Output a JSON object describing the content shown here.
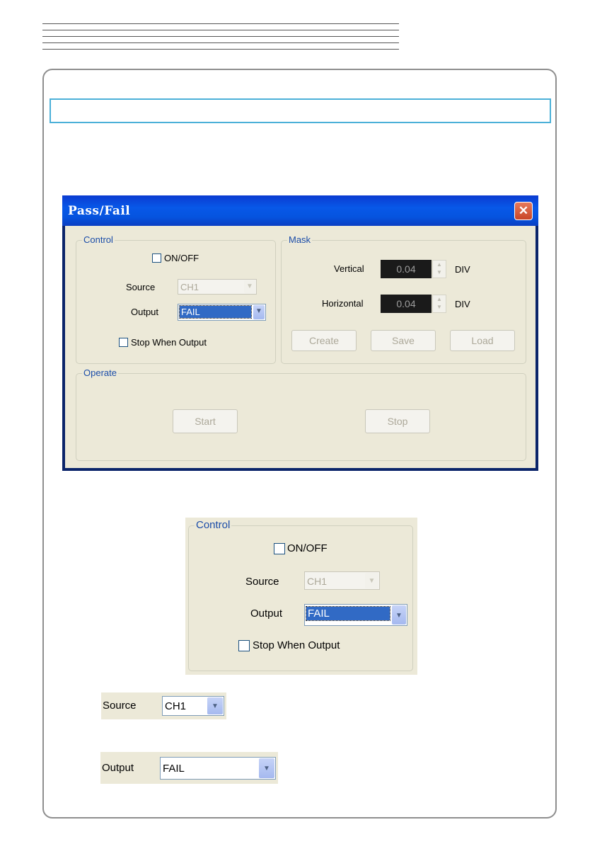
{
  "dialog": {
    "title": "Pass/Fail",
    "close_glyph": "✕",
    "control": {
      "legend": "Control",
      "onoff_label": "ON/OFF",
      "onoff_checked": false,
      "source_label": "Source",
      "source_value": "CH1",
      "output_label": "Output",
      "output_value": "FAIL",
      "stop_when_output_label": "Stop When Output",
      "stop_when_output_checked": false
    },
    "mask": {
      "legend": "Mask",
      "vertical_label": "Vertical",
      "vertical_value": "0.04",
      "vertical_unit": "DIV",
      "horizontal_label": "Horizontal",
      "horizontal_value": "0.04",
      "horizontal_unit": "DIV",
      "create_label": "Create",
      "save_label": "Save",
      "load_label": "Load"
    },
    "operate": {
      "legend": "Operate",
      "start_label": "Start",
      "stop_label": "Stop"
    }
  },
  "zoom_control": {
    "legend": "Control",
    "onoff_label": "ON/OFF",
    "source_label": "Source",
    "source_value": "CH1",
    "output_label": "Output",
    "output_value": "FAIL",
    "stop_when_output_label": "Stop When Output"
  },
  "source_example": {
    "label": "Source",
    "value": "CH1"
  },
  "output_example": {
    "label": "Output",
    "value": "FAIL"
  },
  "colors": {
    "titlebar": "#0858e8",
    "dialog_bg": "#ece9d8",
    "group_legend": "#1a4ca8",
    "selection": "#316ac5",
    "spin_box": "#1a1a1a",
    "frame_border": "#8e8e8e",
    "title_box_border": "#4bb0d8"
  },
  "icons": {
    "dropdown": "chevron-down-icon",
    "close": "close-icon",
    "spin": "spin-arrows-icon"
  }
}
